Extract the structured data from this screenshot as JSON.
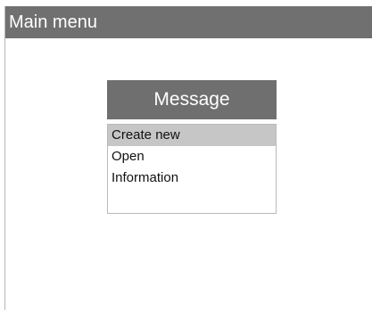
{
  "window": {
    "title": "Main menu"
  },
  "dialog": {
    "title": "Message",
    "items": [
      {
        "label": "Create new",
        "selected": true
      },
      {
        "label": "Open",
        "selected": false
      },
      {
        "label": "Information",
        "selected": false
      }
    ]
  },
  "colors": {
    "titlebar": "#707070",
    "dialog_header": "#6f6f6f",
    "selected_item": "#c6c6c6"
  }
}
